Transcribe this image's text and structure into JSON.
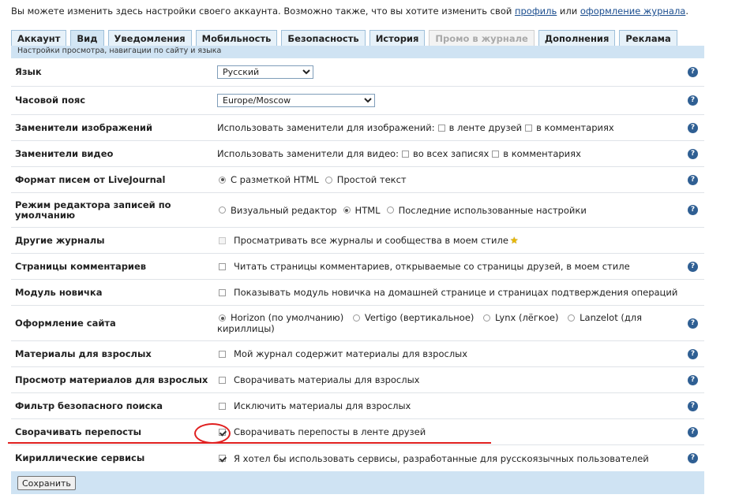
{
  "intro": {
    "text": "Вы можете изменить здесь настройки своего аккаунта. Возможно также, что вы хотите изменить свой ",
    "link1": "профиль",
    "middle": " или ",
    "link2": "оформление журнала",
    "end": "."
  },
  "tabs": [
    {
      "label": "Аккаунт"
    },
    {
      "label": "Вид"
    },
    {
      "label": "Уведомления"
    },
    {
      "label": "Мобильность"
    },
    {
      "label": "Безопасность"
    },
    {
      "label": "История"
    },
    {
      "label": "Промо в журнале"
    },
    {
      "label": "Дополнения"
    },
    {
      "label": "Реклама"
    }
  ],
  "subtitle": "Настройки просмотра, навигации по сайту и языка",
  "help_glyph": "?",
  "rows": {
    "language": {
      "label": "Язык",
      "value": "Русский"
    },
    "timezone": {
      "label": "Часовой пояс",
      "value": "Europe/Moscow"
    },
    "image_placeholders": {
      "label": "Заменители изображений",
      "text": "Использовать заменители для изображений:",
      "opt1": "в ленте друзей",
      "opt2": "в комментариях"
    },
    "video_placeholders": {
      "label": "Заменители видео",
      "text": "Использовать заменители для видео:",
      "opt1": "во всех записях",
      "opt2": "в комментариях"
    },
    "email_format": {
      "label": "Формат писем от LiveJournal",
      "opt1": "С разметкой HTML",
      "opt2": "Простой текст"
    },
    "editor_mode": {
      "label": "Режим редактора записей по умолчанию",
      "opt1": "Визуальный редактор",
      "opt2": "HTML",
      "opt3": "Последние использованные настройки"
    },
    "other_journals": {
      "label": "Другие журналы",
      "text": "Просматривать все журналы и сообщества в моем стиле"
    },
    "comment_pages": {
      "label": "Страницы комментариев",
      "text": "Читать страницы комментариев, открываемые со страницы друзей, в моем стиле"
    },
    "newbie_module": {
      "label": "Модуль новичка",
      "text": "Показывать модуль новичка на домашней странице и страницах подтверждения операций"
    },
    "site_design": {
      "label": "Оформление сайта",
      "opt1": "Horizon (по умолчанию)",
      "opt2": "Vertigo (вертикальное)",
      "opt3": "Lynx (лёгкое)",
      "opt4": "Lanzelot (для кириллицы)"
    },
    "adult_content": {
      "label": "Материалы для взрослых",
      "text": "Мой журнал содержит материалы для взрослых"
    },
    "adult_view": {
      "label": "Просмотр материалов для взрослых",
      "text": "Сворачивать материалы для взрослых"
    },
    "safe_search": {
      "label": "Фильтр безопасного поиска",
      "text": "Исключить материалы для взрослых"
    },
    "collapse_reposts": {
      "label": "Сворачивать перепосты",
      "text": "Сворачивать перепосты в ленте друзей"
    },
    "cyrillic_services": {
      "label": "Кириллические сервисы",
      "text": "Я хотел бы использовать сервисы, разработанные для русскоязычных пользователей"
    }
  },
  "save_label": "Сохранить",
  "colors": {
    "annotation": "#e02020",
    "tab_bg": "#e6f1f9",
    "bar_bg": "#cfe3f3",
    "help": "#2f5f93"
  }
}
